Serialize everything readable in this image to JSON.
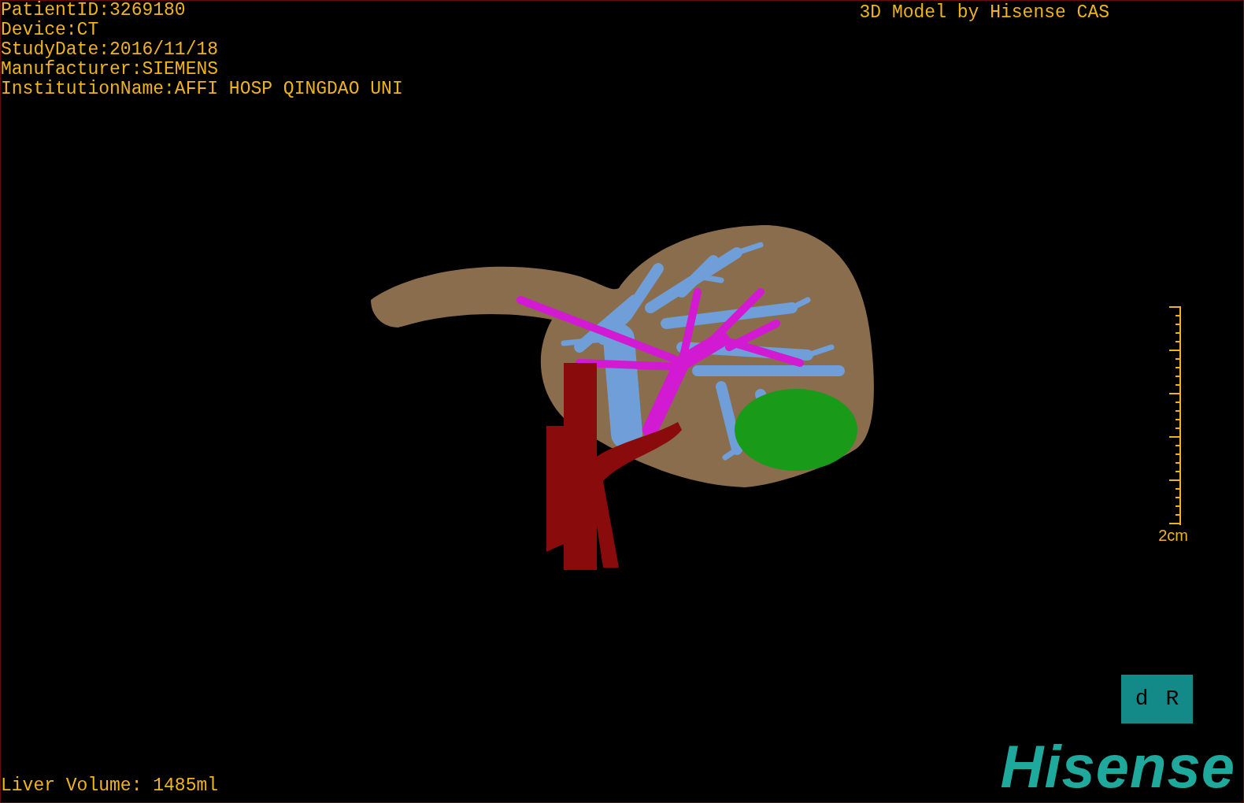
{
  "header": {
    "patient_info": [
      "PatientID:3269180",
      "Device:CT",
      "StudyDate:2016/11/18",
      "Manufacturer:SIEMENS",
      "InstitutionName:AFFI HOSP QINGDAO UNI"
    ],
    "title": "3D Model by Hisense CAS"
  },
  "scale_bar": {
    "label": "2cm"
  },
  "orientation_cube": {
    "labels": [
      "d",
      "R"
    ]
  },
  "footer": {
    "measurement": "Liver Volume: 1485ml",
    "logo": "Hisense"
  }
}
